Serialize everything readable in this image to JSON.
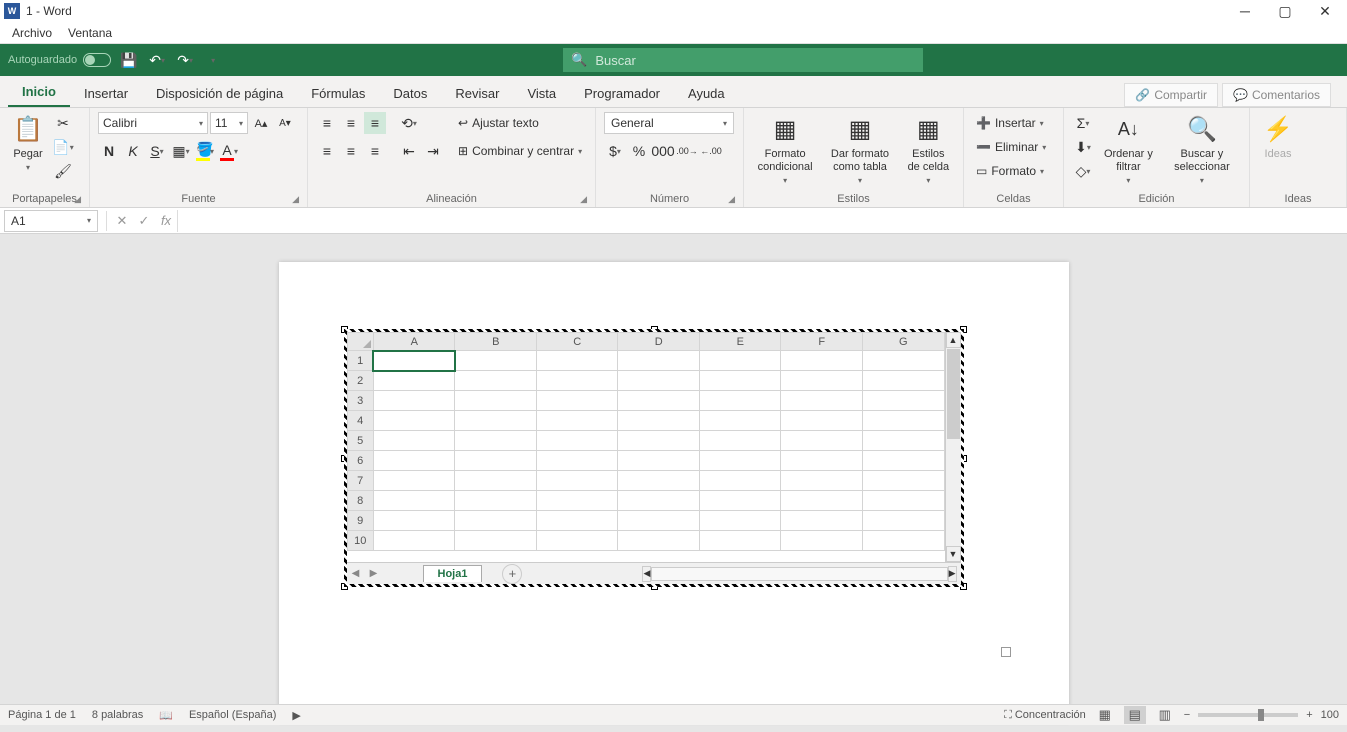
{
  "titlebar": {
    "title": "1 - Word"
  },
  "menubar": {
    "items": [
      "Archivo",
      "Ventana"
    ]
  },
  "quickaccess": {
    "autosave": "Autoguardado"
  },
  "search": {
    "placeholder": "Buscar"
  },
  "tabs": {
    "items": [
      "Inicio",
      "Insertar",
      "Disposición de página",
      "Fórmulas",
      "Datos",
      "Revisar",
      "Vista",
      "Programador",
      "Ayuda"
    ],
    "active": "Inicio",
    "share": "Compartir",
    "comments": "Comentarios"
  },
  "ribbon": {
    "clipboard": {
      "label": "Portapapeles",
      "paste": "Pegar"
    },
    "font": {
      "label": "Fuente",
      "name": "Calibri",
      "size": "11"
    },
    "alignment": {
      "label": "Alineación",
      "wrap": "Ajustar texto",
      "merge": "Combinar y centrar"
    },
    "number": {
      "label": "Número",
      "format": "General"
    },
    "styles": {
      "label": "Estilos",
      "cond": "Formato condicional",
      "table": "Dar formato como tabla",
      "cell": "Estilos de celda"
    },
    "cells": {
      "label": "Celdas",
      "insert": "Insertar",
      "delete": "Eliminar",
      "format": "Formato"
    },
    "editing": {
      "label": "Edición",
      "sort": "Ordenar y filtrar",
      "find": "Buscar y seleccionar"
    },
    "ideas": {
      "label": "Ideas",
      "btn": "Ideas"
    }
  },
  "formula": {
    "namebox": "A1"
  },
  "embed": {
    "columns": [
      "A",
      "B",
      "C",
      "D",
      "E",
      "F",
      "G"
    ],
    "rows": [
      "1",
      "2",
      "3",
      "4",
      "5",
      "6",
      "7",
      "8",
      "9",
      "10"
    ],
    "sheet_tab": "Hoja1",
    "selected": "A1"
  },
  "statusbar": {
    "page": "Página 1 de 1",
    "words": "8 palabras",
    "lang": "Español (España)",
    "focus": "Concentración",
    "zoom": "100"
  }
}
